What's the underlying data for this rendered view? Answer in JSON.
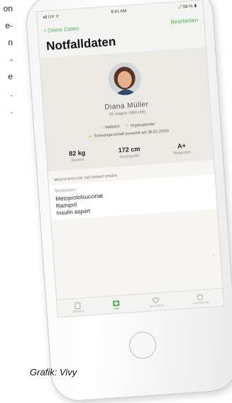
{
  "background_text": {
    "lines": [
      "on",
      "e-",
      "n",
      "-",
      "e",
      ".",
      "."
    ]
  },
  "credit": "Grafik: Vivy",
  "status_bar": {
    "carrier": "all UV ᯤ",
    "time": "8:41 AM",
    "battery": "⤢ 58 % ▮"
  },
  "nav": {
    "back_label": "Deine Daten",
    "edit_label": "Bearbeiten"
  },
  "page": {
    "title": "Notfalldaten"
  },
  "profile": {
    "name": "Diana Müller",
    "birth": "20. August 1969 (49)",
    "gender": "Weiblich",
    "donor": "Organspender",
    "pregnancy": "Schwangerschaft (erwartet am 30.02.2019)"
  },
  "stats": [
    {
      "value": "82 kg",
      "label": "Gewicht"
    },
    {
      "value": "172 cm",
      "label": "Körpergröße"
    },
    {
      "value": "A+",
      "label": "Blutgruppe"
    }
  ],
  "medical": {
    "section_title": "MEDIZINISCHE INFORMATIONEN",
    "med_label": "Medikation:",
    "medications": [
      "Metoprololsuccinat",
      "Ramipril",
      "Insulin aspart"
    ]
  },
  "tabbar": [
    {
      "label": "Übersicht",
      "icon": "document-icon"
    },
    {
      "label": "Hilfe",
      "icon": "firstaid-icon"
    },
    {
      "label": "Gesundheit",
      "icon": "heart-icon"
    },
    {
      "label": "Versicherung",
      "icon": "shield-icon"
    }
  ],
  "colors": {
    "accent": "#58b45a",
    "warning": "#e6b32d",
    "heart": "#d9534f"
  }
}
